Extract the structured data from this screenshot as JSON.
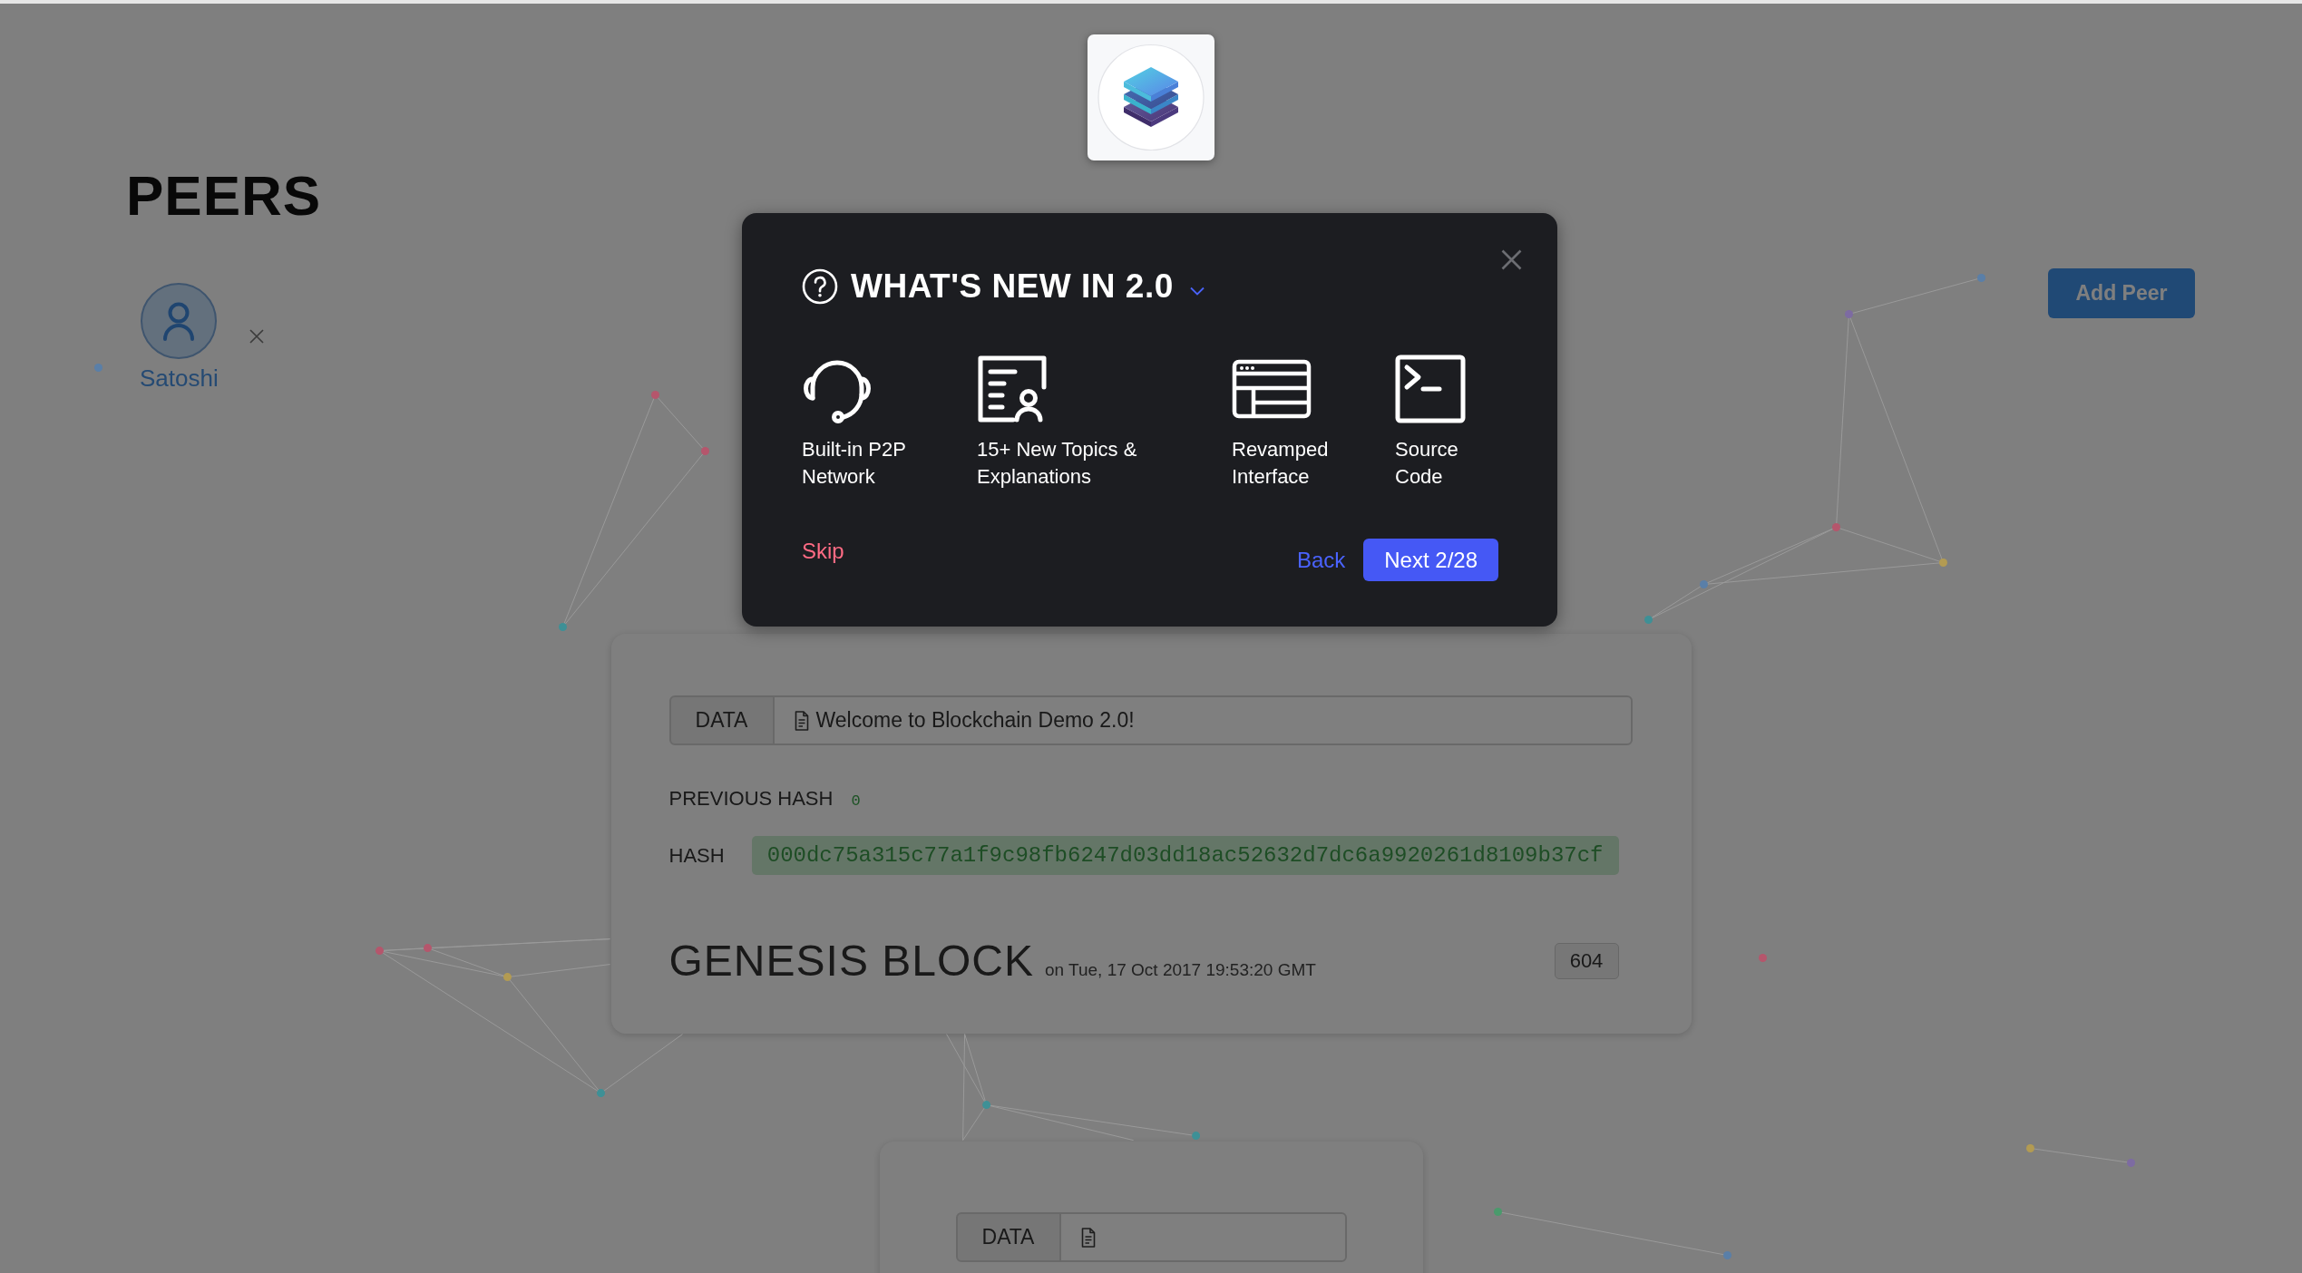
{
  "peers": {
    "title": "PEERS",
    "items": [
      {
        "name": "Satoshi"
      }
    ],
    "add_button": "Add Peer"
  },
  "blocks": [
    {
      "data_label": "DATA",
      "data": "Welcome to Blockchain Demo 2.0!",
      "previous_hash_label": "PREVIOUS HASH",
      "previous_hash": "0",
      "hash_label": "HASH",
      "hash": "000dc75a315c77a1f9c98fb6247d03dd18ac52632d7dc6a9920261d8109b37cf",
      "valid": true,
      "title": "GENESIS BLOCK",
      "timestamp": "on Tue, 17 Oct 2017 19:53:20 GMT",
      "nonce": "604"
    },
    {
      "data_label": "DATA"
    }
  ],
  "modal": {
    "title": "WHAT'S NEW IN 2.0",
    "features": [
      {
        "kind": "headset",
        "label": "Built-in P2P\nNetwork"
      },
      {
        "kind": "document-person",
        "label": "15+ New Topics &\nExplanations"
      },
      {
        "kind": "window",
        "label": "Revamped\nInterface"
      },
      {
        "kind": "terminal",
        "label": "Source\nCode"
      }
    ],
    "skip": "Skip",
    "back": "Back",
    "next": "Next 2/28"
  }
}
